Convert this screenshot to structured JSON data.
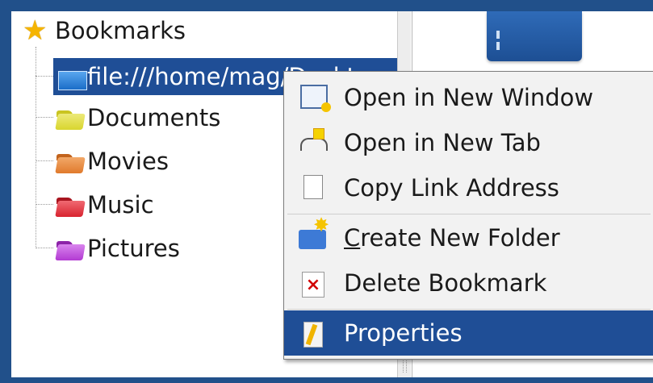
{
  "tree": {
    "root_label": "Bookmarks",
    "items": [
      {
        "label": "file:///home/mag/Desktop",
        "icon": "desktop-icon",
        "selected": true
      },
      {
        "label": "Documents",
        "icon": "folder-icon",
        "color": "#d9d62e"
      },
      {
        "label": "Movies",
        "icon": "folder-icon",
        "color": "#e07a2c"
      },
      {
        "label": "Music",
        "icon": "folder-icon",
        "color": "#d8232f"
      },
      {
        "label": "Pictures",
        "icon": "folder-icon",
        "color": "#b23ad2"
      }
    ]
  },
  "context_menu": {
    "items": [
      {
        "label": "Open in New Window",
        "icon": "new-window-icon"
      },
      {
        "label": "Open in New Tab",
        "icon": "new-tab-icon"
      },
      {
        "label": "Copy Link Address",
        "icon": "copy-icon"
      },
      {
        "label_mnemonic": "C",
        "label_rest": "reate New Folder",
        "icon": "new-folder-icon"
      },
      {
        "label": "Delete Bookmark",
        "icon": "delete-icon"
      },
      {
        "label": "Properties",
        "icon": "properties-icon",
        "highlighted": true
      }
    ]
  },
  "colors": {
    "selection": "#1f4e96",
    "frame": "#21508a"
  }
}
